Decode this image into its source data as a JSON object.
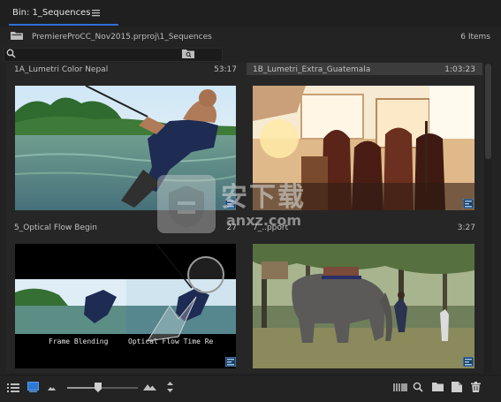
{
  "panel": {
    "tab_title": "Bin: 1_Sequences",
    "path": "PremiereProCC_Nov2015.prproj\\1_Sequences",
    "items_count": "6 Items"
  },
  "clips": [
    {
      "name": "1A_Lumetri Color Nepal",
      "duration": "53:17",
      "selected": false
    },
    {
      "name": "1B_Lumetri_Extra_Guatemala",
      "duration": "1:03:23",
      "selected": true
    },
    {
      "name": "5_Optical Flow Begin",
      "duration": "27",
      "selected": false
    },
    {
      "name": "7_..pport",
      "duration": "3:27",
      "selected": false
    }
  ],
  "thumb_texts": {
    "frame_blending": "Frame Blending",
    "optical_flow": "Optical Flow Time Re"
  },
  "watermark": {
    "text": "安下载",
    "url": "anxz.com"
  },
  "colors": {
    "accent": "#2f6fd6",
    "panel_bg": "#232323"
  },
  "icons": {
    "list_view": "list-view-icon",
    "icon_view": "icon-view-icon",
    "zoom_small": "mountain-small-icon",
    "zoom_large": "mountain-large-icon",
    "sort": "sort-icon",
    "automate": "automate-to-sequence-icon",
    "find": "find-icon",
    "new_bin": "new-bin-icon",
    "new_item": "new-item-icon",
    "clear": "trash-icon"
  },
  "zoom_level": 0.45
}
